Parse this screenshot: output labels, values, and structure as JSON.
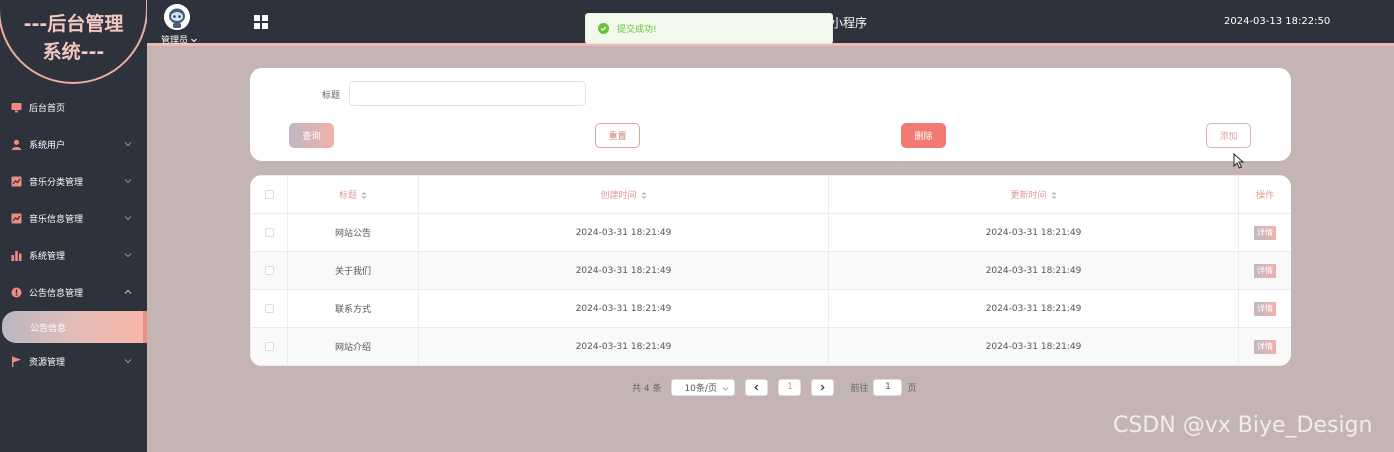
{
  "sidebar": {
    "logo_lines": [
      "---后台管理",
      "系统---"
    ],
    "items": [
      {
        "label": "后台首页",
        "icon": "monitor-icon"
      },
      {
        "label": "系统用户",
        "icon": "user-icon"
      },
      {
        "label": "音乐分类管理",
        "icon": "chart-icon"
      },
      {
        "label": "音乐信息管理",
        "icon": "chart-icon"
      },
      {
        "label": "系统管理",
        "icon": "bar-chart-icon"
      },
      {
        "label": "公告信息管理",
        "icon": "info-icon"
      },
      {
        "label": "资源管理",
        "icon": "flag-icon"
      }
    ],
    "active_sub": "公告信息"
  },
  "header": {
    "user": "管理员",
    "title_fragment": "小程序",
    "datetime": "2024-03-13 18:22:50"
  },
  "toast": {
    "text": "提交成功!"
  },
  "search": {
    "title_label": "标题",
    "title_value": "",
    "query_label": "查询",
    "reset_label": "重置",
    "delete_label": "删除",
    "add_label": "添加"
  },
  "table": {
    "columns": [
      "标题",
      "创建时间",
      "更新时间",
      "操作"
    ],
    "rows": [
      {
        "title": "网站公告",
        "created": "2024-03-31 18:21:49",
        "updated": "2024-03-31 18:21:49",
        "action": "详情"
      },
      {
        "title": "关于我们",
        "created": "2024-03-31 18:21:49",
        "updated": "2024-03-31 18:21:49",
        "action": "详情"
      },
      {
        "title": "联系方式",
        "created": "2024-03-31 18:21:49",
        "updated": "2024-03-31 18:21:49",
        "action": "详情"
      },
      {
        "title": "网站介绍",
        "created": "2024-03-31 18:21:49",
        "updated": "2024-03-31 18:21:49",
        "action": "详情"
      }
    ]
  },
  "pagination": {
    "total": "共 4 条",
    "page_size": "10条/页",
    "current": "1",
    "goto_label": "前往",
    "goto_value": "1",
    "page_unit": "页"
  },
  "watermark": "CSDN @vx Biye_Design",
  "colors": {
    "accent": "#f17a73",
    "sidebar": "#2d323c",
    "background": "#c4b5b4"
  }
}
